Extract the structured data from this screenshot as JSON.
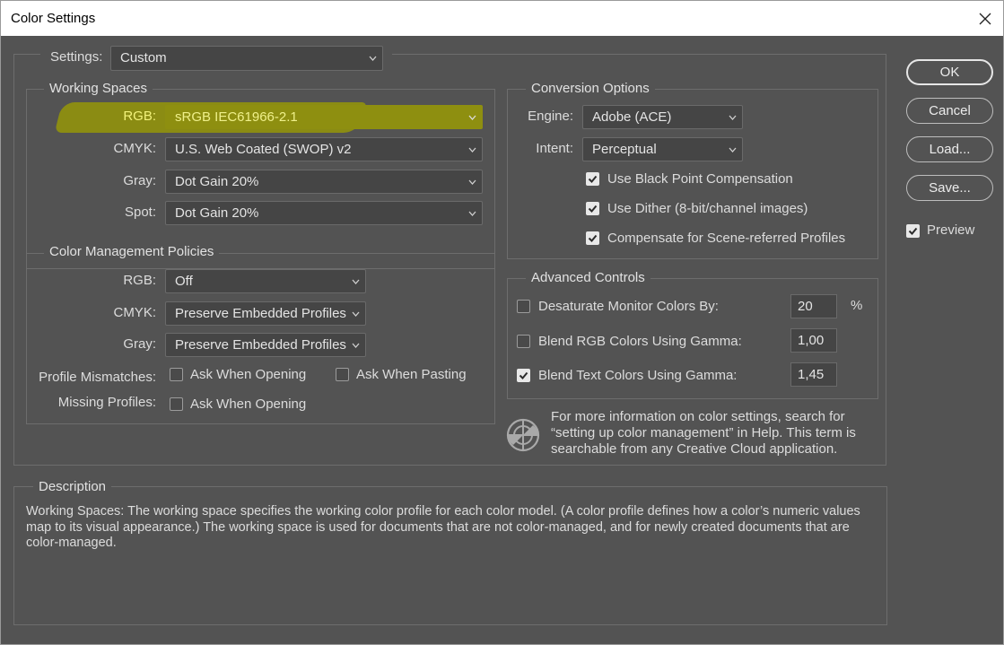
{
  "window": {
    "title": "Color Settings"
  },
  "settings": {
    "label": "Settings:",
    "value": "Custom"
  },
  "working_spaces": {
    "title": "Working Spaces",
    "rows": [
      {
        "label": "RGB:",
        "value": "sRGB IEC61966-2.1"
      },
      {
        "label": "CMYK:",
        "value": "U.S. Web Coated (SWOP) v2"
      },
      {
        "label": "Gray:",
        "value": "Dot Gain 20%"
      },
      {
        "label": "Spot:",
        "value": "Dot Gain 20%"
      }
    ]
  },
  "policies": {
    "title": "Color Management Policies",
    "rows": [
      {
        "label": "RGB:",
        "value": "Off"
      },
      {
        "label": "CMYK:",
        "value": "Preserve Embedded Profiles"
      },
      {
        "label": "Gray:",
        "value": "Preserve Embedded Profiles"
      }
    ],
    "mismatches_label": "Profile Mismatches:",
    "mismatch_open": {
      "label": "Ask When Opening",
      "checked": false
    },
    "mismatch_paste": {
      "label": "Ask When Pasting",
      "checked": false
    },
    "missing_label": "Missing Profiles:",
    "missing_open": {
      "label": "Ask When Opening",
      "checked": false
    }
  },
  "conversion": {
    "title": "Conversion Options",
    "engine_label": "Engine:",
    "engine_value": "Adobe (ACE)",
    "intent_label": "Intent:",
    "intent_value": "Perceptual",
    "black_point": {
      "label": "Use Black Point Compensation",
      "checked": true
    },
    "dither": {
      "label": "Use Dither (8-bit/channel images)",
      "checked": true
    },
    "scene_referred": {
      "label": "Compensate for Scene-referred Profiles",
      "checked": true
    }
  },
  "advanced": {
    "title": "Advanced Controls",
    "desaturate": {
      "label": "Desaturate Monitor Colors By:",
      "checked": false,
      "value": "20",
      "unit": "%"
    },
    "blend_rgb": {
      "label": "Blend RGB Colors Using Gamma:",
      "checked": false,
      "value": "1,00"
    },
    "blend_text": {
      "label": "Blend Text Colors Using Gamma:",
      "checked": true,
      "value": "1,45"
    }
  },
  "info": {
    "text": "For more information on color settings, search for “setting up color management” in Help. This term is searchable from any Creative Cloud application."
  },
  "buttons": {
    "ok": "OK",
    "cancel": "Cancel",
    "load": "Load...",
    "save": "Save..."
  },
  "preview": {
    "label": "Preview",
    "checked": true
  },
  "description": {
    "title": "Description",
    "text": "Working Spaces:  The working space specifies the working color profile for each color model.  (A color profile defines how a color’s numeric values map to its visual appearance.)  The working space is used for documents that are not color-managed, and for newly created documents that are color-managed."
  },
  "colors": {
    "background": "#535353",
    "highlight": "#8e8f10",
    "highlight_text": "#f2f27a"
  }
}
